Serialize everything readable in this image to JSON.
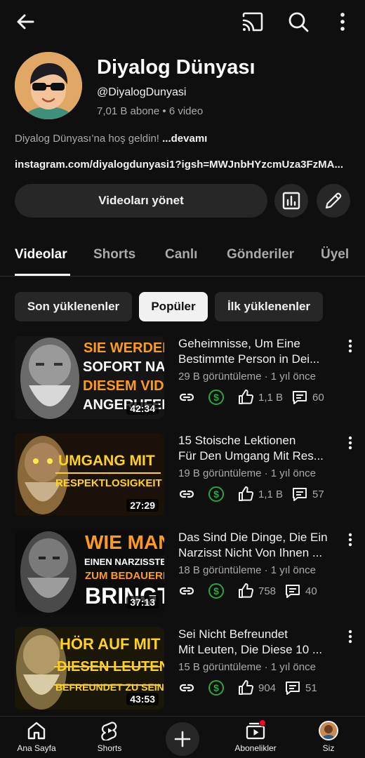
{
  "channel": {
    "name": "Diyalog Dünyası",
    "handle": "@DiyalogDunyasi",
    "stats": "7,01 B abone • 6 video",
    "description": "Diyalog Dünyası’na hoş geldin! ",
    "description_more": "...devamı",
    "link": "instagram.com/diyalogdunyasi1?igsh=MWJnbHYzcmUza3FzMA..."
  },
  "actions": {
    "manage_label": "Videoları yönet"
  },
  "tabs": [
    {
      "label": "Videolar",
      "active": true
    },
    {
      "label": "Shorts"
    },
    {
      "label": "Canlı"
    },
    {
      "label": "Gönderiler"
    },
    {
      "label": "Üyel"
    }
  ],
  "chips": [
    {
      "label": "Son yüklenenler"
    },
    {
      "label": "Popüler",
      "selected": true
    },
    {
      "label": "İlk yüklenenler"
    }
  ],
  "videos": [
    {
      "title_line1": "Geheimnisse, Um Eine",
      "title_line2": "Bestimmte Person in Dei...",
      "meta": "29 B görüntüleme · 1 yıl önce",
      "likes": "1,1 B",
      "comments": "60",
      "duration": "42:34",
      "thumb_lines": [
        "SIE WERDEN",
        "SOFORT NACH",
        "DIESEM VIDEO",
        "ANGERUFEN"
      ]
    },
    {
      "title_line1": "15 Stoische Lektionen",
      "title_line2": "Für Den Umgang Mit Res...",
      "meta": "19 B görüntüleme · 1 yıl önce",
      "likes": "1,1 B",
      "comments": "57",
      "duration": "27:29",
      "thumb_lines": [
        "UMGANG MIT",
        "RESPEKTLOSIGKEIT"
      ]
    },
    {
      "title_line1": "Das Sind Die Dinge, Die Ein",
      "title_line2": "Narzisst Nicht Von Ihnen ...",
      "meta": "18 B görüntüleme · 1 yıl önce",
      "likes": "758",
      "comments": "40",
      "duration": "37:13",
      "thumb_lines": [
        "WIE MAN",
        "EINEN NARZISSTEN",
        "ZUM BEDAUERN",
        "BRINGT"
      ]
    },
    {
      "title_line1": "Sei Nicht Befreundet",
      "title_line2": "Mit Leuten, Die Diese 10 ...",
      "meta": "15 B görüntüleme · 1 yıl önce",
      "likes": "904",
      "comments": "51",
      "duration": "43:53",
      "thumb_lines": [
        "HÖR AUF MIT",
        "DIESEN LEUTEN",
        "BEFREUNDET ZU SEIN"
      ]
    }
  ],
  "bottom_nav": {
    "home": "Ana Sayfa",
    "shorts": "Shorts",
    "subscriptions": "Abonelikler",
    "you": "Siz"
  },
  "colors": {
    "background": "#0f0f0f",
    "surface": "#272727",
    "text_primary": "#f1f1f1",
    "text_secondary": "#aaaaaa",
    "money_green": "#2ba640",
    "thumb_yellow": "#ffd21f",
    "thumb_orange": "#ff9a1a",
    "notification_red": "#ff0033"
  }
}
